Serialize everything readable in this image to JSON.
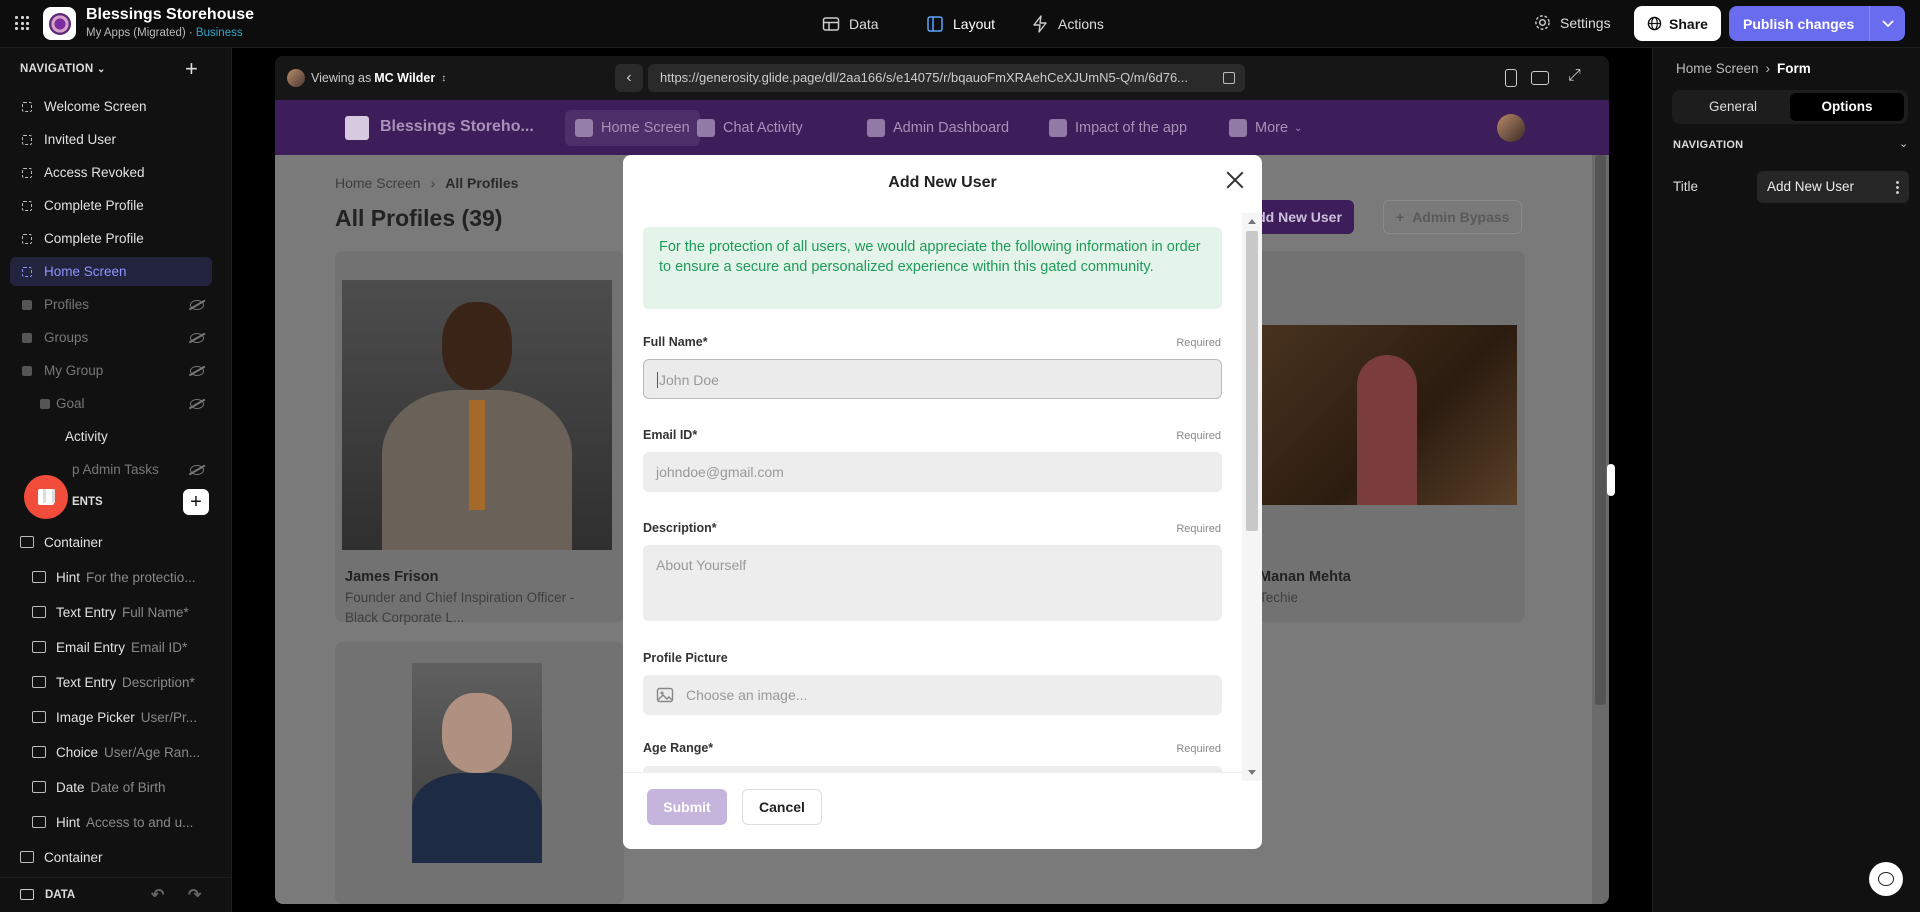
{
  "app": {
    "title": "Blessings Storehouse",
    "subtitle": "My Apps (Migrated) · ",
    "plan": "Business"
  },
  "topnav": {
    "data": "Data",
    "layout": "Layout",
    "actions": "Actions",
    "settings": "Settings",
    "share": "Share",
    "publish": "Publish changes"
  },
  "left": {
    "nav_header": "NAVIGATION",
    "screens": [
      {
        "label": "Welcome Screen"
      },
      {
        "label": "Invited User"
      },
      {
        "label": "Access Revoked"
      },
      {
        "label": "Complete Profile"
      },
      {
        "label": "Complete Profile"
      },
      {
        "label": "Home Screen"
      },
      {
        "label": "Profiles"
      },
      {
        "label": "Groups"
      },
      {
        "label": "My Group"
      },
      {
        "label": "Goal"
      },
      {
        "label": "Activity"
      },
      {
        "label": "p Admin Tasks"
      }
    ],
    "components_header": "ENTS",
    "components": [
      {
        "type": "Container",
        "sub": ""
      },
      {
        "type": "Hint",
        "sub": "For the protectio..."
      },
      {
        "type": "Text Entry",
        "sub": "Full Name*"
      },
      {
        "type": "Email Entry",
        "sub": "Email ID*"
      },
      {
        "type": "Text Entry",
        "sub": "Description*"
      },
      {
        "type": "Image Picker",
        "sub": "User/Pr..."
      },
      {
        "type": "Choice",
        "sub": "User/Age Ran..."
      },
      {
        "type": "Date",
        "sub": "Date of Birth"
      },
      {
        "type": "Hint",
        "sub": "Access to and u..."
      },
      {
        "type": "Container",
        "sub": ""
      }
    ],
    "data_label": "DATA"
  },
  "preview": {
    "viewing_prefix": "Viewing as ",
    "viewing_user": "MC Wilder",
    "url": "https://generosity.glide.page/dl/2aa166/s/e14075/r/bqauoFmXRAehCeXJUmN5-Q/m/6d76...",
    "brand": "Blessings Storeho...",
    "tabs": [
      "Home Screen",
      "Chat Activity",
      "Admin Dashboard",
      "Impact of the app",
      "More"
    ],
    "breadcrumb_parent": "Home Screen",
    "breadcrumb_current": "All Profiles",
    "page_title": "All Profiles (39)",
    "add_user_btn": "Add New User",
    "admin_bypass_btn": "Admin Bypass",
    "cards": [
      {
        "name": "James Frison",
        "role": "Founder and Chief Inspiration Officer - Black Corporate L..."
      },
      {
        "name": "Manan Mehta",
        "role": "Techie"
      }
    ]
  },
  "modal": {
    "title": "Add New User",
    "hint": "For the protection of all users, we would appreciate the following information in order to ensure a secure and personalized experience within this gated community.",
    "required": "Required",
    "fields": {
      "full_name": {
        "label": "Full Name*",
        "placeholder": "John Doe"
      },
      "email": {
        "label": "Email ID*",
        "placeholder": "johndoe@gmail.com"
      },
      "description": {
        "label": "Description*",
        "placeholder": "About Yourself"
      },
      "picture": {
        "label": "Profile Picture",
        "placeholder": "Choose an image..."
      },
      "age": {
        "label": "Age Range*"
      }
    },
    "submit": "Submit",
    "cancel": "Cancel"
  },
  "right": {
    "crumb_parent": "Home Screen",
    "crumb_current": "Form",
    "tab_general": "General",
    "tab_options": "Options",
    "section": "NAVIGATION",
    "title_label": "Title",
    "title_value": "Add New User"
  }
}
